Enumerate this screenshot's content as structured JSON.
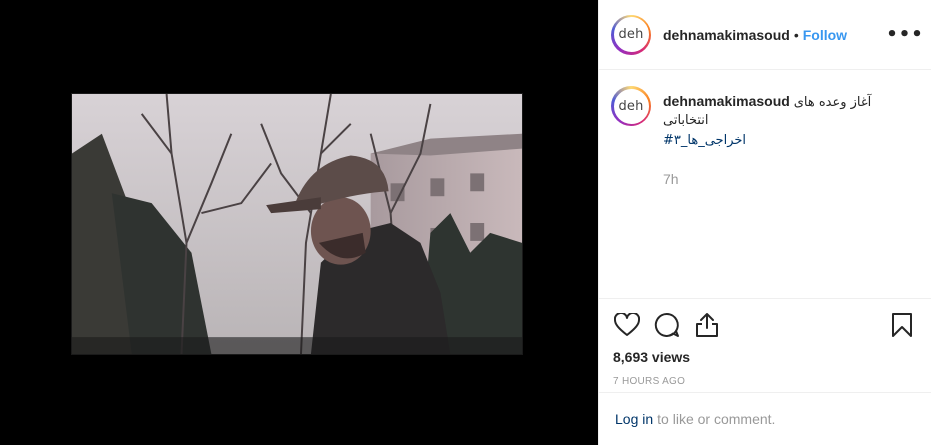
{
  "post": {
    "username": "dehnamakimasoud",
    "avatar_text": "deh",
    "separator": "•",
    "follow_label": "Follow",
    "more_label": "•••",
    "caption": {
      "username": "dehnamakimasoud",
      "line1": "آغاز وعده های",
      "line2": "انتخاباتی",
      "hashtag": "#اخراجی_ها_۳"
    },
    "relative_time": "7h",
    "views": "8,693 views",
    "absolute_time": "7 HOURS AGO",
    "login_link": "Log in",
    "login_text": "to like or comment."
  },
  "icons": {
    "like": "heart-icon",
    "comment": "comment-icon",
    "share": "share-icon",
    "save": "bookmark-icon",
    "more": "more-options-icon"
  },
  "colors": {
    "follow": "#3897f0",
    "link": "#003569",
    "muted": "#999999",
    "media_bg": "#000000"
  }
}
